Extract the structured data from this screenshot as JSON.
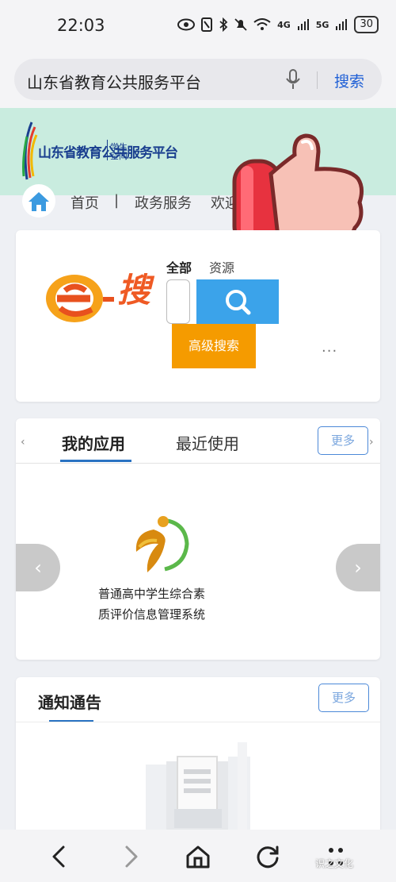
{
  "status": {
    "time": "22:03",
    "net1": "4G",
    "net2": "5G",
    "battery": "30"
  },
  "browser": {
    "query": "山东省教育公共服务平台",
    "search_label": "搜索"
  },
  "site": {
    "logo_text": "山东省教育公共服务平台",
    "logo_sub": "学生空间",
    "nav": [
      "首页",
      "|",
      "政务服务",
      "欢迎"
    ]
  },
  "search_card": {
    "logo_text": "搜",
    "tabs": [
      "全部",
      "资源"
    ],
    "advanced_label": "高级搜索",
    "more_dots": "···"
  },
  "apps_card": {
    "tabs": [
      "我的应用",
      "最近使用"
    ],
    "more_label": "更多",
    "app_name_line1": "普通高中学生综合素",
    "app_name_line2": "质评价信息管理系统"
  },
  "notice_card": {
    "title": "通知通告",
    "more_label": "更多"
  },
  "watermark": "识之文化",
  "colors": {
    "header_green": "#c9ecdf",
    "link_blue": "#1e5fd6",
    "search_btn": "#3ba3ea",
    "advanced_btn": "#f59b00",
    "tab_underline": "#2a73c2"
  }
}
